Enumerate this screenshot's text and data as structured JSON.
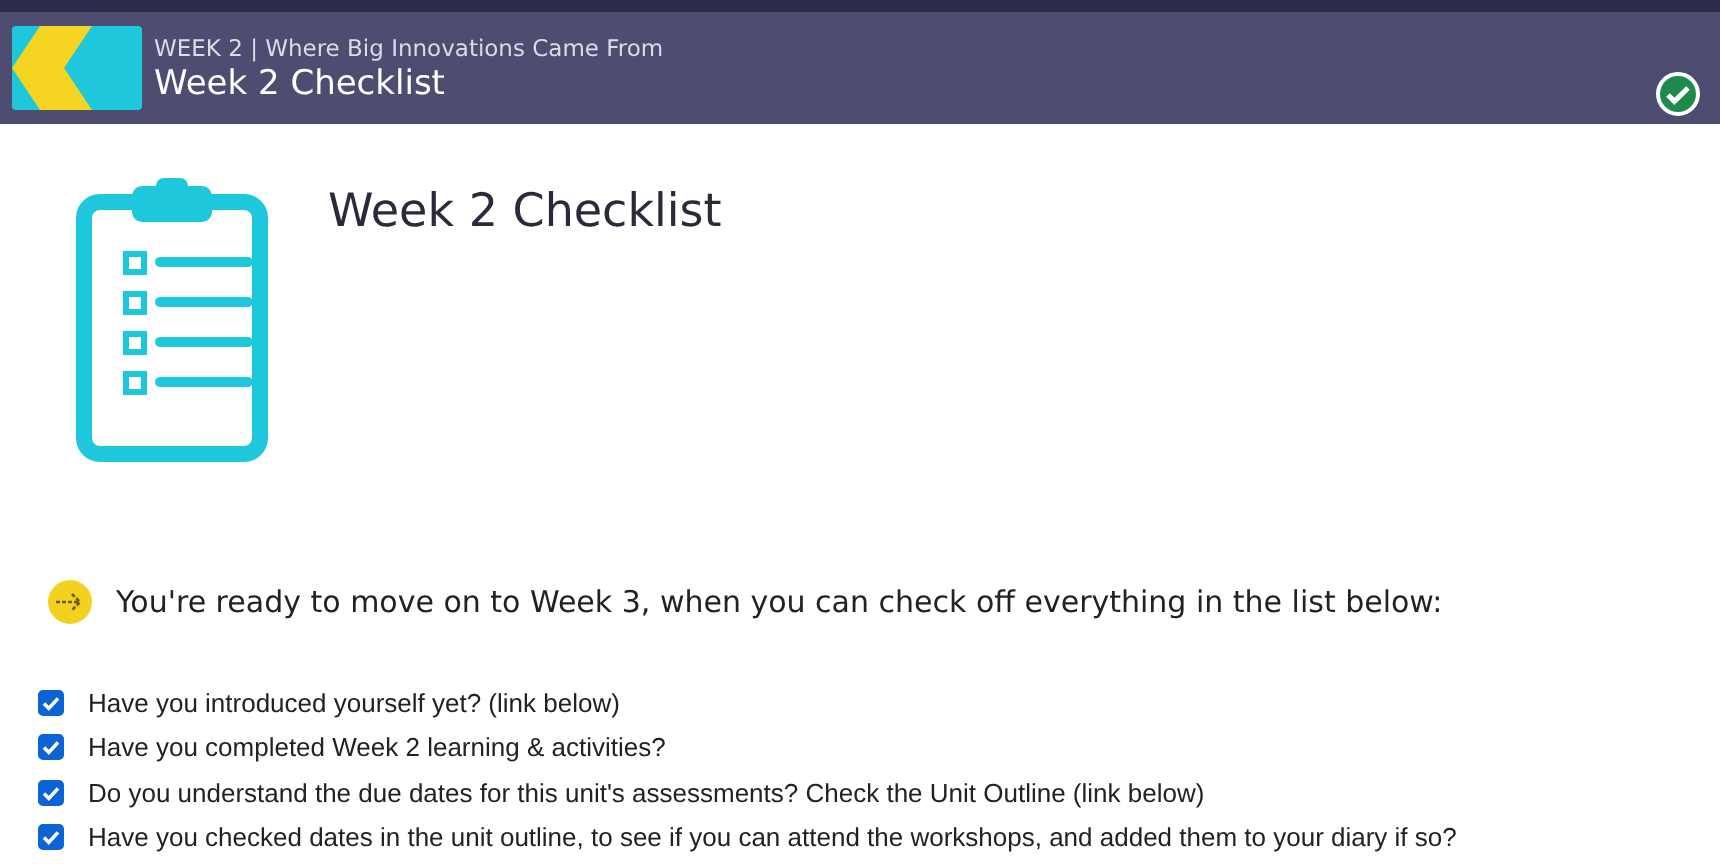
{
  "header": {
    "breadcrumb": "WEEK 2 | Where Big Innovations Came From",
    "title": "Week 2 Checklist",
    "completed": true
  },
  "page": {
    "heading": "Week 2 Checklist",
    "intro": "You're ready to move on to Week 3, when you can check off everything in the list below:",
    "items": [
      {
        "label": "Have you introduced yourself yet? (link below)",
        "checked": true
      },
      {
        "label": "Have you completed Week 2 learning & activities?",
        "checked": true
      },
      {
        "label": "Do you understand the due dates for this unit's assessments? Check the Unit Outline (link below)",
        "checked": true
      },
      {
        "label": "Have you checked dates in the unit outline, to see if you can attend the workshops, and added them to your diary if so?",
        "checked": true
      }
    ]
  }
}
